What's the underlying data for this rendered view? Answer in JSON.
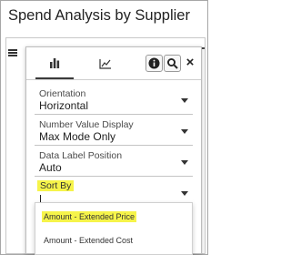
{
  "page": {
    "title": "Spend Analysis by Supplier"
  },
  "toolbar": {
    "tabs": [
      {
        "icon": "bar-chart-icon",
        "active": true
      },
      {
        "icon": "line-chart-icon",
        "active": false
      }
    ],
    "info_icon": "info-icon",
    "zoom_icon": "zoom-icon",
    "close_label": "×"
  },
  "fields": [
    {
      "label": "Orientation",
      "value": "Horizontal"
    },
    {
      "label": "Number Value Display",
      "value": "Max Mode Only"
    },
    {
      "label": "Data Label Position",
      "value": "Auto"
    },
    {
      "label": "Sort By",
      "value": ""
    }
  ],
  "sort_options": [
    {
      "label": "Amount - Extended Price",
      "highlighted": true
    },
    {
      "label": "Amount - Extended Cost",
      "highlighted": false
    }
  ],
  "colors": {
    "highlight": "#f6f44a",
    "border": "#bdbdbd",
    "text": "#222222"
  }
}
